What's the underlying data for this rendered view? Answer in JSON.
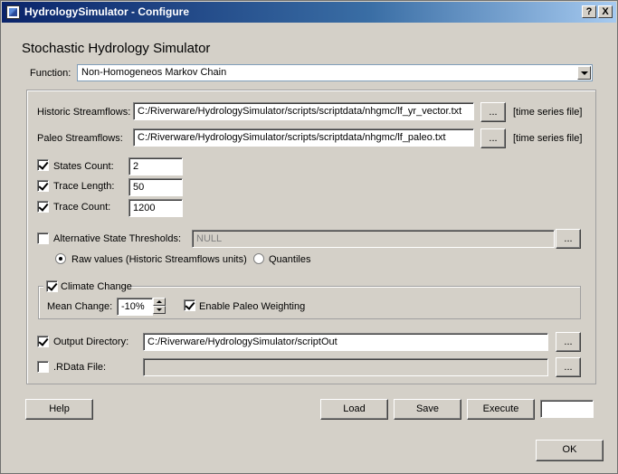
{
  "window": {
    "title": "HydrologySimulator - Configure",
    "help_glyph": "?",
    "close_glyph": "X"
  },
  "heading": "Stochastic Hydrology Simulator",
  "function": {
    "label": "Function:",
    "value": "Non-Homogeneos Markov Chain"
  },
  "historic": {
    "label": "Historic Streamflows:",
    "value": "C:/Riverware/HydrologySimulator/scripts/scriptdata/nhgmc/lf_yr_vector.txt",
    "browse": "...",
    "hint": "[time series file]"
  },
  "paleo": {
    "label": "Paleo Streamflows:",
    "value": "C:/Riverware/HydrologySimulator/scripts/scriptdata/nhgmc/lf_paleo.txt",
    "browse": "...",
    "hint": "[time series file]"
  },
  "states_count": {
    "label": "States Count:",
    "value": "2",
    "checked": true
  },
  "trace_length": {
    "label": "Trace Length:",
    "value": "50",
    "checked": true
  },
  "trace_count": {
    "label": "Trace Count:",
    "value": "1200",
    "checked": true
  },
  "alt_thresholds": {
    "label": "Alternative State Thresholds:",
    "value": "NULL",
    "checked": false,
    "browse": "...",
    "options": [
      "Raw values (Historic Streamflows units)",
      "Quantiles"
    ],
    "selected": "Raw values (Historic Streamflows units)"
  },
  "climate_change": {
    "label": "Climate Change",
    "checked": true,
    "mean_change_label": "Mean Change:",
    "mean_change_value": "-10%",
    "paleo_weighting_label": "Enable Paleo Weighting",
    "paleo_weighting_checked": true
  },
  "output_dir": {
    "label": "Output Directory:",
    "value": "C:/Riverware/HydrologySimulator/scriptOut",
    "checked": true,
    "browse": "..."
  },
  "rdata": {
    "label": ".RData File:",
    "value": "",
    "checked": false,
    "browse": "..."
  },
  "buttons": {
    "help": "Help",
    "load": "Load",
    "save": "Save",
    "execute": "Execute",
    "ok": "OK"
  },
  "status_box": ""
}
